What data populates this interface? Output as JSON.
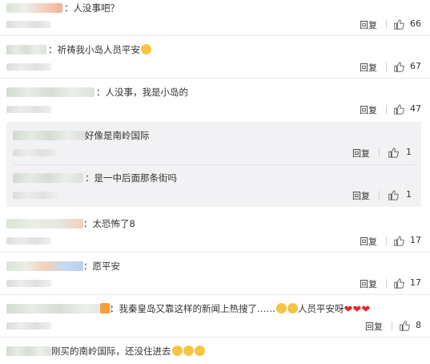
{
  "comments": [
    {
      "text": "：人没事吧？",
      "reply": "回复",
      "likes": "66"
    },
    {
      "text": "：祈祷我小岛人员平安",
      "reply": "回复",
      "likes": "67"
    },
    {
      "text": "：人没事，我是小岛的",
      "reply": "回复",
      "likes": "47"
    },
    {
      "text": "好像是南岭国际",
      "reply": "回复",
      "likes": "1"
    },
    {
      "text": "：是一中后面那条街吗",
      "reply": "回复",
      "likes": "1"
    },
    {
      "text": "：太恐怖了8",
      "reply": "回复",
      "likes": "17"
    },
    {
      "text": "：愿平安",
      "reply": "回复",
      "likes": "17"
    },
    {
      "text": "：我秦皇岛又靠这样的新闻上热搜了……",
      "text2": "人员平安呀",
      "reply": "回复",
      "likes": "8"
    },
    {
      "text": "刚买的南岭国际，还没住进去"
    }
  ],
  "icons": {
    "thumb": "thumbs-up-icon",
    "emoji_cry": "crying-emoji-icon",
    "emoji_laugh": "laughing-emoji-icon",
    "heart": "heart-icon"
  }
}
